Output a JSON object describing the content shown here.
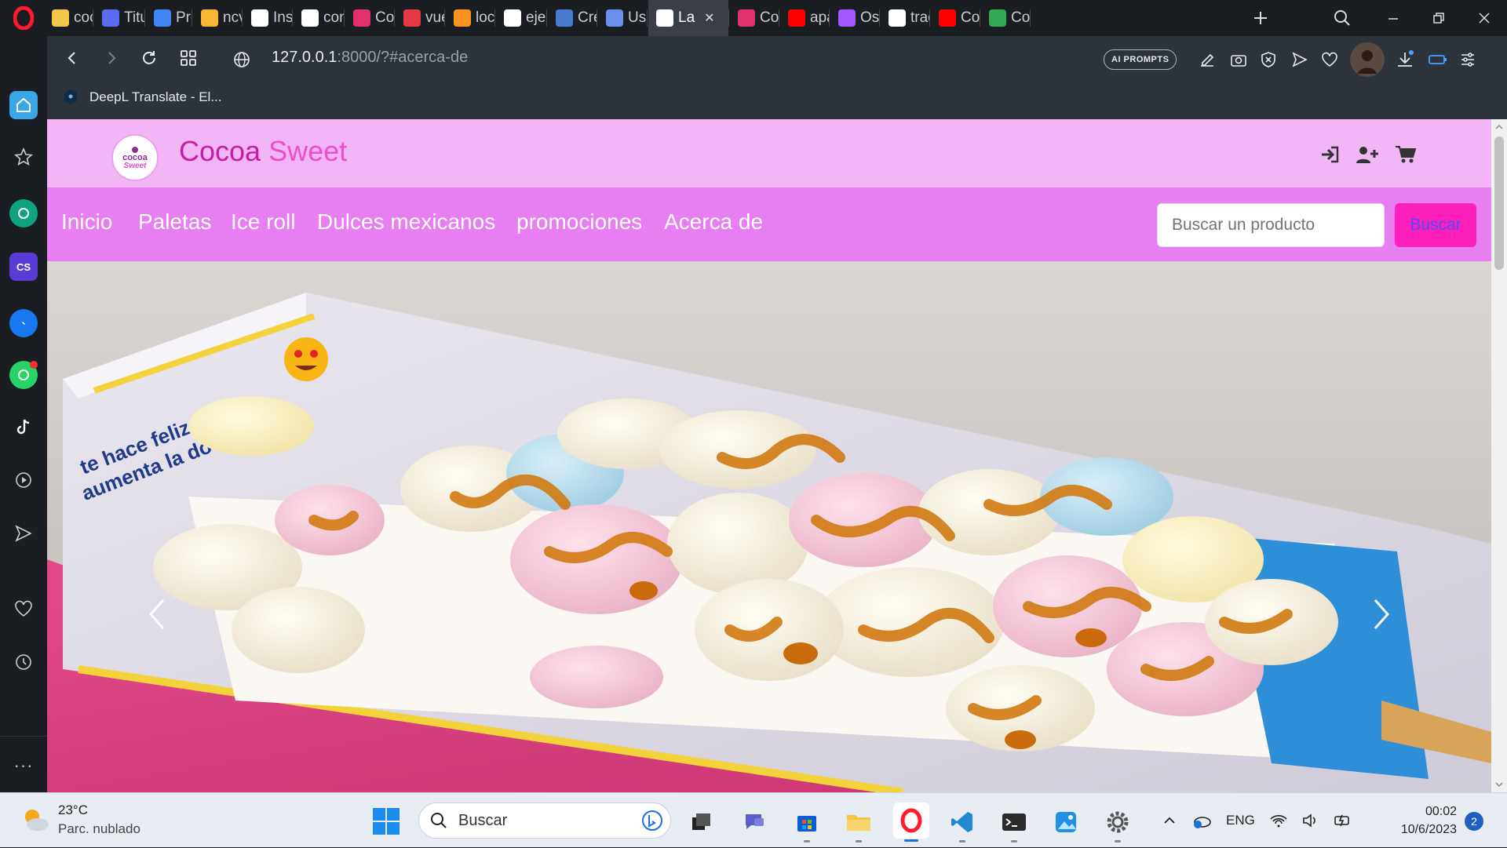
{
  "browser": {
    "tabs": [
      {
        "label": "coc",
        "icon": "miro-icon",
        "color": "#f2c94c"
      },
      {
        "label": "Titu",
        "icon": "chat-bot-icon",
        "color": "#5b6cf0"
      },
      {
        "label": "Pro",
        "icon": "docs-icon",
        "color": "#4285f4"
      },
      {
        "label": "ncv",
        "icon": "hand-icon",
        "color": "#f7b733"
      },
      {
        "label": "Inst",
        "icon": "github-icon",
        "color": "#ffffff"
      },
      {
        "label": "con",
        "icon": "google-icon",
        "color": "#ffffff"
      },
      {
        "label": "Coc",
        "icon": "instagram-icon",
        "color": "#e1306c"
      },
      {
        "label": "vue",
        "icon": "codepen-icon",
        "color": "#e63946"
      },
      {
        "label": "loca",
        "icon": "xampp-icon",
        "color": "#f7931e"
      },
      {
        "label": "ejer",
        "icon": "google-icon",
        "color": "#ffffff"
      },
      {
        "label": "Cre",
        "icon": "a-icon",
        "color": "#4a7bd0"
      },
      {
        "label": "Use",
        "icon": "flag-icon",
        "color": "#6d8eea"
      },
      {
        "label": "La",
        "icon": "globe-icon",
        "color": "#ffffff",
        "active": true
      },
      {
        "label": "Coc",
        "icon": "instagram-icon",
        "color": "#e1306c"
      },
      {
        "label": "apa",
        "icon": "youtube-icon",
        "color": "#ff0000"
      },
      {
        "label": "Osv",
        "icon": "figma-icon",
        "color": "#a259ff"
      },
      {
        "label": "trac",
        "icon": "google-icon",
        "color": "#ffffff"
      },
      {
        "label": "Cor",
        "icon": "youtube-icon",
        "color": "#ff0000"
      },
      {
        "label": "Coc",
        "icon": "maps-icon",
        "color": "#34a853"
      }
    ],
    "url_host": "127.0.0.1",
    "url_rest": ":8000/?#acerca-de",
    "ai_prompts_label": "AI PROMPTS",
    "bookmark_label": "DeepL Translate - El..."
  },
  "site": {
    "brand_part1": "Cocoa",
    "brand_part2": " Sweet",
    "logo_text_top": "cocoa",
    "logo_text_bottom": "Sweet",
    "nav": [
      "Inicio",
      "Paletas",
      "Ice roll",
      "Dulces mexicanos",
      "promociones",
      "Acerca de"
    ],
    "search_placeholder": "Buscar un producto",
    "search_button": "Buscar",
    "hero_box_text": "te hace feliz aumenta la dosis",
    "colors": {
      "header": "#f2b5f6",
      "navbar": "#e77ff2",
      "brand": "#c81ca5",
      "button": "#ff1fba"
    }
  },
  "taskbar": {
    "temperature": "23°C",
    "weather_desc": "Parc. nublado",
    "search_label": "Buscar",
    "language": "ENG",
    "time": "00:02",
    "date": "10/6/2023",
    "notifications": "2"
  }
}
